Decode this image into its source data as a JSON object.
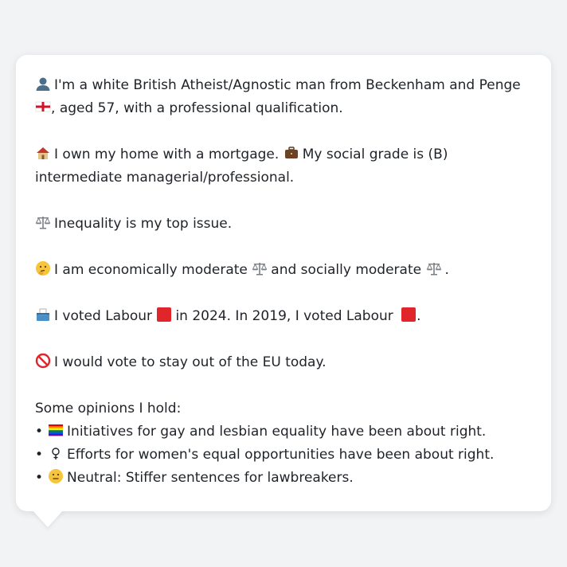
{
  "profile": {
    "p1": {
      "icon": "person-silhouette-icon",
      "text_a": "I'm a white British Atheist/Agnostic man from Beckenham and Penge",
      "flag": "england-flag-icon",
      "text_b": ",",
      "text_c": "aged 57, with a professional qualification."
    },
    "p2": {
      "icon1": "house-icon",
      "text_a": "I own my home with a mortgage.",
      "icon2": "briefcase-icon",
      "text_b": "My social grade is (B) intermediate managerial/professional."
    },
    "p3": {
      "icon": "balance-scale-icon",
      "text": "Inequality is my top issue."
    },
    "p4": {
      "icon": "thinking-face-icon",
      "text_a": "I am economically moderate",
      "text_b": "and socially moderate",
      "text_c": "."
    },
    "p5": {
      "icon": "ballot-box-icon",
      "text_a": "I voted Labour",
      "text_b": "in 2024. In 2019, I voted Labour",
      "text_c": ".",
      "labour_color": "#e0262b"
    },
    "p6": {
      "icon": "prohibited-icon",
      "text": "I would vote to stay out of the EU today."
    },
    "opinions_heading": "Some opinions I hold:",
    "opinions": [
      {
        "icon": "rainbow-flag-icon",
        "text": "Initiatives for gay and lesbian equality have been about right."
      },
      {
        "icon": "female-sign-icon",
        "text": "Efforts for women's equal opportunities have been about right."
      },
      {
        "icon": "neutral-face-icon",
        "text": "Neutral: Stiffer sentences for lawbreakers."
      }
    ],
    "bullet": "•"
  }
}
